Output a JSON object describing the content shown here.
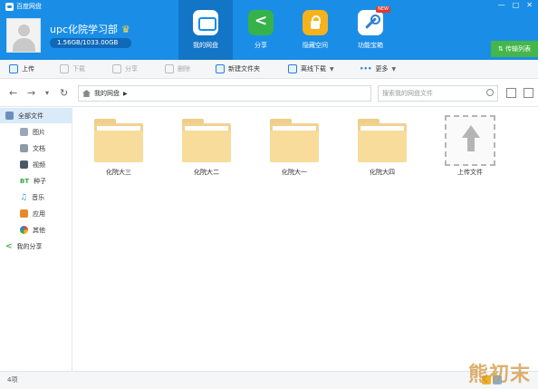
{
  "app": {
    "title": "百度网盘"
  },
  "user": {
    "name": "upc化院学习部",
    "quota": "1.56GB/1033.00GB"
  },
  "nav": [
    {
      "label": "我的网盘",
      "icon": "disk-icon",
      "active": true
    },
    {
      "label": "分享",
      "icon": "share-icon",
      "active": false
    },
    {
      "label": "隐藏空间",
      "icon": "lock-icon",
      "active": false
    },
    {
      "label": "功能宝箱",
      "icon": "toolbox-icon",
      "active": false,
      "badge": "NEW"
    }
  ],
  "window": {
    "minimize": "—",
    "maximize": "□",
    "close": "✕"
  },
  "transfer": {
    "label": "传输列表"
  },
  "toolbar": {
    "upload": "上传",
    "download": "下载",
    "share": "分享",
    "delete": "删除",
    "new_folder": "新建文件夹",
    "offline": "离线下载",
    "more": "更多"
  },
  "address": {
    "path": "我的网盘",
    "search_placeholder": "搜索我的网盘文件"
  },
  "sidebar": [
    {
      "label": "全部文件",
      "active": true
    },
    {
      "label": "图片"
    },
    {
      "label": "文档"
    },
    {
      "label": "视频"
    },
    {
      "label": "种子"
    },
    {
      "label": "音乐"
    },
    {
      "label": "应用"
    },
    {
      "label": "其他"
    },
    {
      "label": "我的分享"
    }
  ],
  "files": [
    {
      "name": "化院大三",
      "type": "folder"
    },
    {
      "name": "化院大二",
      "type": "folder"
    },
    {
      "name": "化院大一",
      "type": "folder"
    },
    {
      "name": "化院大四",
      "type": "folder"
    },
    {
      "name": "上传文件",
      "type": "upload"
    }
  ],
  "status": {
    "count": "4项"
  },
  "watermark": "熊初末"
}
